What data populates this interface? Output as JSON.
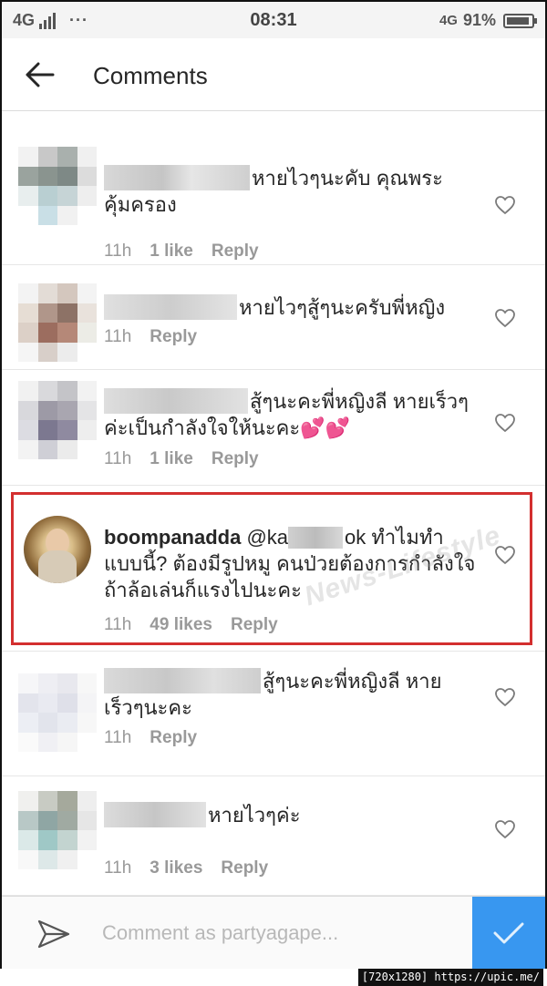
{
  "status_bar": {
    "network": "4G",
    "dots": "···",
    "time": "08:31",
    "network_right": "4G",
    "battery": "91%",
    "battery_level": 0.91
  },
  "header": {
    "title": "Comments"
  },
  "comments": [
    {
      "text": "หายไวๆนะคับ คุณพระคุ้มครอง",
      "time": "11h",
      "likes": "1 like",
      "reply": "Reply"
    },
    {
      "text": "หายไวๆสู้ๆนะครับพี่หญิง",
      "time": "11h",
      "likes": "",
      "reply": "Reply"
    },
    {
      "text": "สู้ๆนะคะพี่หญิงลี หายเร็วๆค่ะเป็นกำลังใจให้นะคะ💕💕",
      "time": "11h",
      "likes": "1 like",
      "reply": "Reply"
    },
    {
      "username": "boompanadda",
      "mention": "@ka",
      "mention_end": "ok",
      "text": "ทำไมทำแบบนี้? ต้องมีรูปหมู คนป่วยต้องการกำลังใจ ถ้าล้อเล่นก็แรงไปนะคะ",
      "time": "11h",
      "likes": "49 likes",
      "reply": "Reply"
    },
    {
      "text": "สู้ๆนะคะพี่หญิงลี หายเร็วๆนะคะ",
      "time": "11h",
      "likes": "",
      "reply": "Reply"
    },
    {
      "text": "หายไวๆค่ะ",
      "time": "11h",
      "likes": "3 likes",
      "reply": "Reply"
    }
  ],
  "compose": {
    "placeholder": "Comment as partyagape..."
  },
  "watermark": "News-Lifestyle",
  "footer": "[720x1280] https://upic.me/",
  "colors": {
    "accent": "#3897f0",
    "highlight": "#d32f2f",
    "meta": "#999999"
  },
  "icons": [
    "back-arrow-icon",
    "heart-icon",
    "send-icon",
    "check-icon"
  ]
}
